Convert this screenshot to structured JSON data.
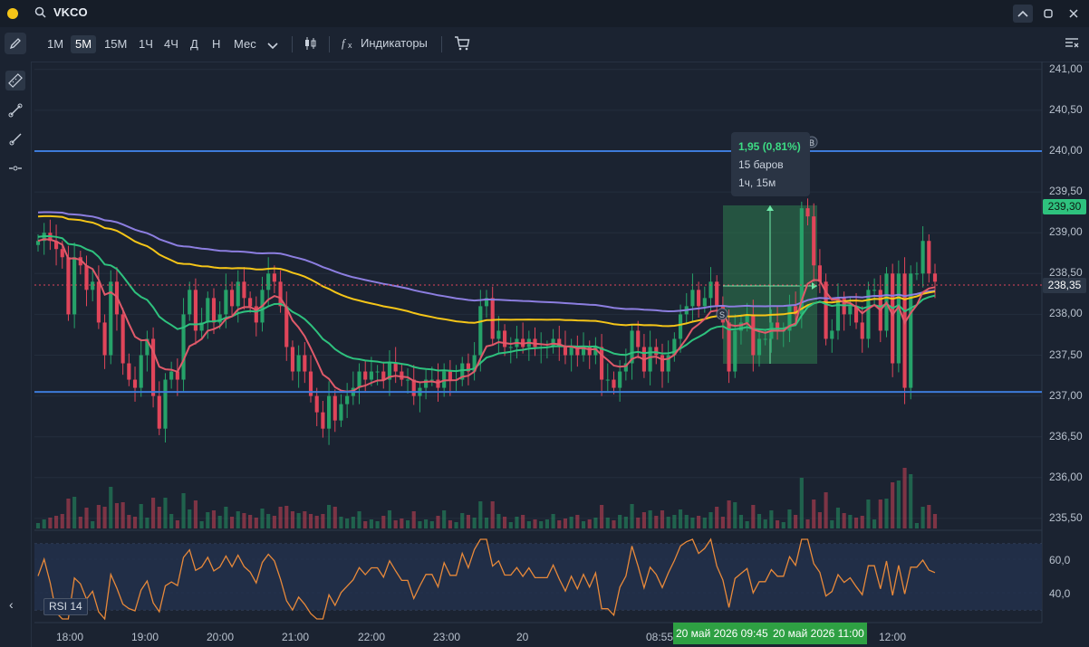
{
  "header": {
    "ticker": "VKCO",
    "icons": [
      "search-icon",
      "chevron-up-icon",
      "square-icon",
      "close-icon"
    ]
  },
  "toolbar": {
    "timeframes": [
      "1М",
      "5М",
      "15М",
      "1Ч",
      "4Ч",
      "Д",
      "Н",
      "Мес"
    ],
    "active_timeframe": "5М",
    "indicators_label": "Индикаторы"
  },
  "price_axis": {
    "labels": [
      "241,00",
      "240,50",
      "240,00",
      "239,50",
      "239,00",
      "238,50",
      "238,00",
      "237,50",
      "237,00",
      "236,50",
      "236,00",
      "235,50"
    ],
    "values": [
      241.0,
      240.5,
      240.0,
      239.5,
      239.0,
      238.5,
      238.0,
      237.5,
      237.0,
      236.5,
      236.0,
      235.5
    ],
    "current_price": "239,30",
    "last_price": "238,35"
  },
  "rsi_axis": {
    "labels": [
      "60,0",
      "40,0"
    ],
    "name": "RSI 14"
  },
  "time_axis": {
    "labels": [
      "18:00",
      "19:00",
      "20:00",
      "21:00",
      "22:00",
      "23:00",
      "20",
      "08:55",
      "12:00"
    ],
    "range_badge_start": "20 май 2026 09:45",
    "range_badge_end": "20 май 2026 11:00"
  },
  "measure_tooltip": {
    "change": "1,95 (0,81%)",
    "bars": "15 баров",
    "duration": "1ч, 15м"
  },
  "markers": {
    "s": "S",
    "b": "B"
  },
  "colors": {
    "up": "#26a269",
    "down": "#e0455a",
    "level_line": "#3d7bd9",
    "ma_yellow": "#f5c518",
    "ma_purple": "#8c7ee0",
    "ma_green": "#2ec27e",
    "ma_red": "#e05a6a",
    "rsi": "#e8893a",
    "measure_fill": "#2e7d4f"
  },
  "levels": [
    240.0,
    237.05
  ],
  "chart_data": {
    "type": "candlestick",
    "series": [
      {
        "name": "close",
        "values": [
          238.9,
          239.0,
          238.9,
          238.8,
          238.7,
          238.0,
          238.7,
          238.6,
          238.3,
          238.4,
          237.9,
          237.5,
          238.4,
          238.0,
          237.4,
          237.2,
          237.1,
          237.5,
          237.7,
          237.0,
          236.6,
          237.2,
          237.3,
          237.2,
          238.0,
          238.3,
          237.8,
          237.9,
          238.2,
          237.9,
          238.0,
          238.3,
          238.1,
          238.4,
          238.2,
          238.1,
          237.9,
          238.3,
          238.5,
          238.4,
          238.1,
          237.6,
          237.3,
          237.5,
          237.3,
          237.0,
          236.8,
          236.6,
          237.0,
          236.7,
          236.9,
          237.0,
          237.1,
          237.3,
          237.2,
          237.3,
          237.3,
          237.2,
          237.4,
          237.3,
          237.2,
          237.2,
          237.0,
          237.1,
          237.2,
          237.2,
          237.1,
          237.3,
          237.2,
          237.2,
          237.4,
          237.3,
          237.5,
          238.1,
          238.2,
          237.7,
          237.8,
          237.6,
          237.6,
          237.7,
          237.6,
          237.7,
          237.6,
          237.6,
          237.6,
          237.7,
          237.6,
          237.5,
          237.6,
          237.5,
          237.6,
          237.5,
          237.6,
          237.2,
          237.2,
          237.1,
          237.3,
          237.4,
          237.8,
          237.6,
          237.3,
          237.6,
          237.5,
          237.3,
          237.5,
          237.7,
          238.0,
          238.1,
          238.3,
          238.1,
          238.2,
          238.4,
          238.1,
          237.9,
          237.3,
          237.8,
          237.9,
          238.0,
          237.5,
          237.7,
          237.7,
          237.9,
          237.8,
          237.8,
          238.1,
          238.0,
          239.3,
          239.2,
          238.6,
          238.4,
          237.7,
          237.8,
          238.2,
          238.0,
          238.1,
          237.9,
          237.7,
          238.3,
          238.3,
          237.8,
          238.5,
          237.4,
          238.5,
          237.1,
          238.5,
          238.5,
          238.9,
          238.5,
          238.4
        ]
      }
    ],
    "volume": [],
    "rsi_range": [
      30,
      70
    ],
    "ylim": [
      235.25,
      241.25
    ]
  }
}
